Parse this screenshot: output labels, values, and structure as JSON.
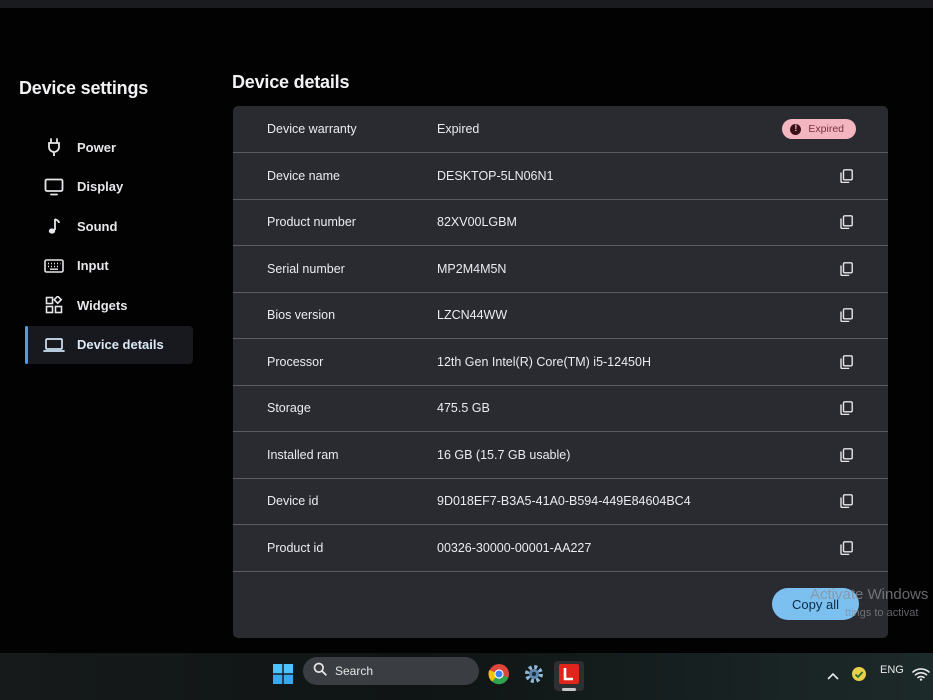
{
  "sidebar": {
    "title": "Device settings",
    "items": [
      {
        "label": "Power",
        "icon": "plug-icon"
      },
      {
        "label": "Display",
        "icon": "monitor-icon"
      },
      {
        "label": "Sound",
        "icon": "music-note-icon"
      },
      {
        "label": "Input",
        "icon": "keyboard-icon"
      },
      {
        "label": "Widgets",
        "icon": "widgets-icon"
      },
      {
        "label": "Device details",
        "icon": "laptop-icon",
        "active": true
      }
    ]
  },
  "main": {
    "title": "Device details",
    "warranty": {
      "label": "Device warranty",
      "value": "Expired",
      "badge": "Expired"
    },
    "rows": [
      {
        "label": "Device name",
        "value": "DESKTOP-5LN06N1"
      },
      {
        "label": "Product number",
        "value": "82XV00LGBM"
      },
      {
        "label": "Serial number",
        "value": "MP2M4M5N"
      },
      {
        "label": "Bios version",
        "value": "LZCN44WW"
      },
      {
        "label": "Processor",
        "value": "12th Gen Intel(R) Core(TM) i5-12450H"
      },
      {
        "label": "Storage",
        "value": "475.5 GB"
      },
      {
        "label": "Installed ram",
        "value": "16 GB (15.7 GB usable)"
      },
      {
        "label": "Device id",
        "value": "9D018EF7-B3A5-41A0-B594-449E84604BC4"
      },
      {
        "label": "Product id",
        "value": "00326-30000-00001-AA227"
      }
    ],
    "copy_all_label": "Copy all"
  },
  "watermark": {
    "line1": "Activate Windows",
    "line2": "ttings to activat"
  },
  "taskbar": {
    "search_label": "Search",
    "language": "ENG",
    "apps": [
      "windows-start-icon",
      "chrome-icon",
      "settings-gear-icon",
      "lenovo-vantage-icon"
    ]
  },
  "colors": {
    "accent": "#4c9de8",
    "copy_button": "#7cc0f0",
    "badge_bg": "#f3b6c1",
    "panel_bg": "#2a2b31"
  }
}
